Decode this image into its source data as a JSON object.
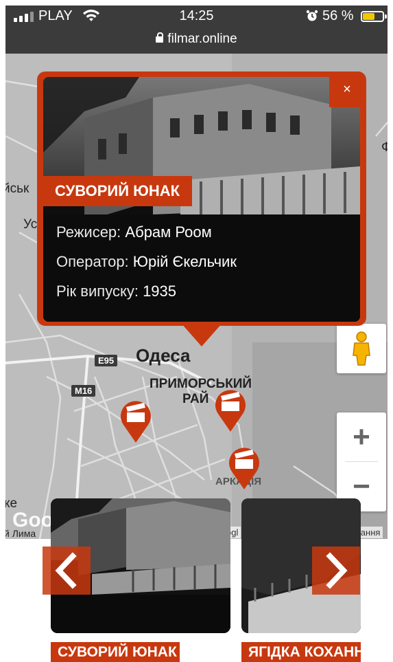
{
  "status_bar": {
    "carrier": "PLAY",
    "time": "14:25",
    "battery_percent": "56 %",
    "battery_level": 0.56,
    "battery_color": "#f3c800",
    "icons": [
      "signal-icon",
      "wifi-icon",
      "alarm-icon",
      "battery-icon"
    ]
  },
  "browser": {
    "url": "filmar.online",
    "icons": [
      "lock-icon"
    ]
  },
  "map": {
    "city_label": "Одеса",
    "district_label_line1": "ПРИМОРСЬКИЙ",
    "district_label_line2": "РАЙ",
    "area_label": "АРКАДІЯ",
    "edge_label_left_1": "йськ",
    "edge_label_left_2": "Ус",
    "edge_label_left_3": "ке",
    "edge_label_left_4": "й Лима",
    "edge_label_right": "Ф",
    "road_e95": "E95",
    "road_m16": "M16",
    "google_logo": "Goo",
    "attribution": "ogl",
    "attribution_right": "тання",
    "zoom_in": "+",
    "zoom_out": "−",
    "pins": [
      "film-marker-icon",
      "film-marker-icon",
      "film-marker-icon"
    ]
  },
  "popup": {
    "close_label": "×",
    "title": "СУВОРИЙ ЮНАК",
    "director_label": "Режисер:",
    "director_value": "Абрам Роом",
    "operator_label": "Оператор:",
    "operator_value": "Юрій Єкельчик",
    "year_label": "Рік випуску:",
    "year_value": "1935"
  },
  "carousel": {
    "prev_icon": "chevron-left-icon",
    "next_icon": "chevron-right-icon",
    "cards": [
      {
        "title": "СУВОРИЙ ЮНАК"
      },
      {
        "title": "ЯГІДКА КОХАНН"
      }
    ]
  },
  "colors": {
    "accent": "#c8380f",
    "status_bar_bg": "#3b3b3b",
    "map_bg": "#bdbdbd"
  }
}
